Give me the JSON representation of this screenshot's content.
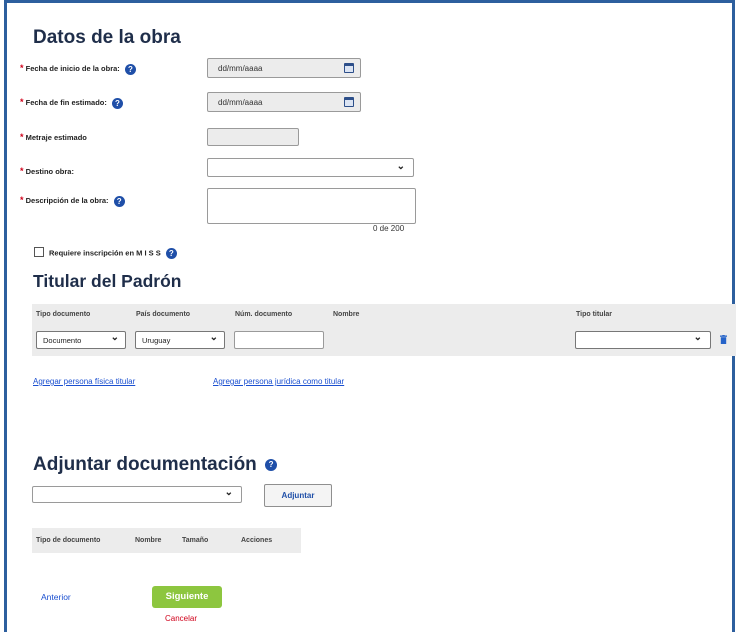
{
  "obra": {
    "title": "Datos de la obra",
    "required_mark": "*",
    "fecha_inicio": {
      "label": "Fecha de inicio de la obra:",
      "placeholder": "dd/mm/aaaa"
    },
    "fecha_fin": {
      "label": "Fecha de fin estimado:",
      "placeholder": "dd/mm/aaaa"
    },
    "metraje": {
      "label": "Metraje estimado",
      "value": ""
    },
    "destino": {
      "label": "Destino obra:",
      "value": ""
    },
    "descripcion": {
      "label": "Descripción de la obra:",
      "value": "",
      "counter": "0 de 200"
    },
    "miss": {
      "label": "Requiere inscripción en M I S S",
      "checked": false
    }
  },
  "titular": {
    "title": "Titular del Padrón",
    "headers": [
      "Tipo documento",
      "País documento",
      "Núm. documento",
      "Nombre",
      "Tipo titular"
    ],
    "row": {
      "tipo_documento": "Documento",
      "pais_documento": "Uruguay",
      "num_documento": "",
      "nombre": "",
      "tipo_titular": ""
    },
    "link_fisica": "Agregar persona física titular",
    "link_juridica": "Agregar persona jurídica como titular"
  },
  "adjuntar": {
    "title": "Adjuntar documentación",
    "select_value": "",
    "button": "Adjuntar",
    "headers": [
      "Tipo de documento",
      "Nombre",
      "Tamaño",
      "Acciones"
    ]
  },
  "nav": {
    "previous": "Anterior",
    "next": "Siguiente",
    "cancel": "Cancelar"
  },
  "colors": {
    "accent": "#1f4fa8",
    "next": "#8dc63f",
    "required": "#d0021b"
  }
}
